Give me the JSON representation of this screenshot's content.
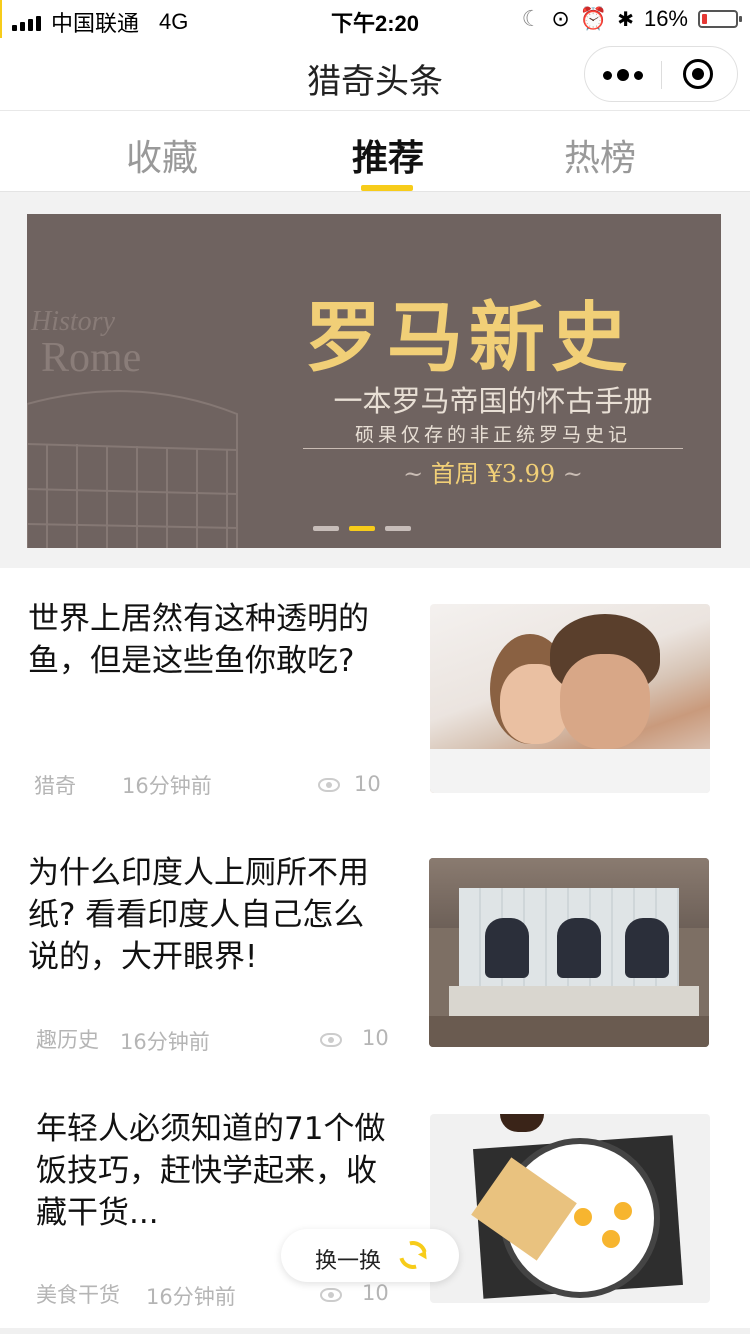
{
  "status_bar": {
    "carrier": "中国联通",
    "network": "4G",
    "time": "下午2:20",
    "battery": "16%",
    "battery_level": 0.16,
    "icons": [
      "moon-icon",
      "orientation-lock-icon",
      "alarm-icon",
      "bluetooth-icon"
    ]
  },
  "nav": {
    "title": "猎奇头条"
  },
  "tabs": [
    {
      "label": "收藏",
      "active": false
    },
    {
      "label": "推荐",
      "active": true
    },
    {
      "label": "热榜",
      "active": false
    }
  ],
  "banner": {
    "title": "罗马新史",
    "subtitle": "一本罗马帝国的怀古手册",
    "subtitle2": "硕果仅存的非正统罗马史记",
    "price": "首周 ¥3.99",
    "bg_text_1": "History",
    "bg_text_2": "Rome",
    "slides": 3,
    "active_slide": 2
  },
  "articles": [
    {
      "title": "世界上居然有这种透明的鱼，但是这些鱼你敢吃?",
      "source": "猎奇",
      "time": "16分钟前",
      "views": "10"
    },
    {
      "title": "为什么印度人上厕所不用纸? 看看印度人自己怎么说的，大开眼界!",
      "source": "趣历史",
      "time": "16分钟前",
      "views": "10"
    },
    {
      "title": "年轻人必须知道的71个做饭技巧，赶快学起来，收藏干货...",
      "source": "美食干货",
      "time": "16分钟前",
      "views": "10"
    }
  ],
  "swap_button": {
    "label": "换一换"
  },
  "colors": {
    "accent": "#f7cc1a",
    "banner_bg": "#6f6360",
    "banner_title": "#f1cf77"
  }
}
